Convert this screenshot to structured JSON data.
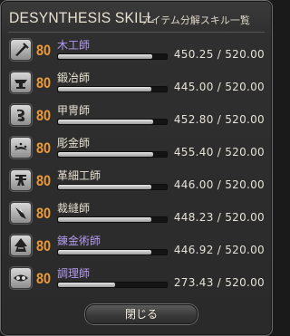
{
  "window": {
    "title": "DESYNTHESIS SKILL",
    "subtitle": "アイテム分解スキル一覧"
  },
  "skills": [
    {
      "job": "木工師",
      "level": "80",
      "value": "450.25 / 520.00",
      "progress": 0.866,
      "highlight": true,
      "icon": "carpenter-icon"
    },
    {
      "job": "鍛冶師",
      "level": "80",
      "value": "445.00 / 520.00",
      "progress": 0.856,
      "highlight": false,
      "icon": "blacksmith-icon"
    },
    {
      "job": "甲冑師",
      "level": "80",
      "value": "452.80 / 520.00",
      "progress": 0.871,
      "highlight": false,
      "icon": "armorer-icon"
    },
    {
      "job": "彫金師",
      "level": "80",
      "value": "455.40 / 520.00",
      "progress": 0.876,
      "highlight": false,
      "icon": "goldsmith-icon"
    },
    {
      "job": "革細工師",
      "level": "80",
      "value": "446.00 / 520.00",
      "progress": 0.858,
      "highlight": false,
      "icon": "leatherworker-icon"
    },
    {
      "job": "裁縫師",
      "level": "80",
      "value": "448.23 / 520.00",
      "progress": 0.862,
      "highlight": false,
      "icon": "weaver-icon"
    },
    {
      "job": "錬金術師",
      "level": "80",
      "value": "446.92 / 520.00",
      "progress": 0.859,
      "highlight": true,
      "icon": "alchemist-icon"
    },
    {
      "job": "調理師",
      "level": "80",
      "value": "273.43 / 520.00",
      "progress": 0.526,
      "highlight": true,
      "icon": "culinarian-icon"
    }
  ],
  "close_button": {
    "label": "閉じる"
  },
  "colors": {
    "level": "#ed9a3a",
    "highlight_name": "#b59cf0",
    "normal_name": "#e9e3d3"
  }
}
